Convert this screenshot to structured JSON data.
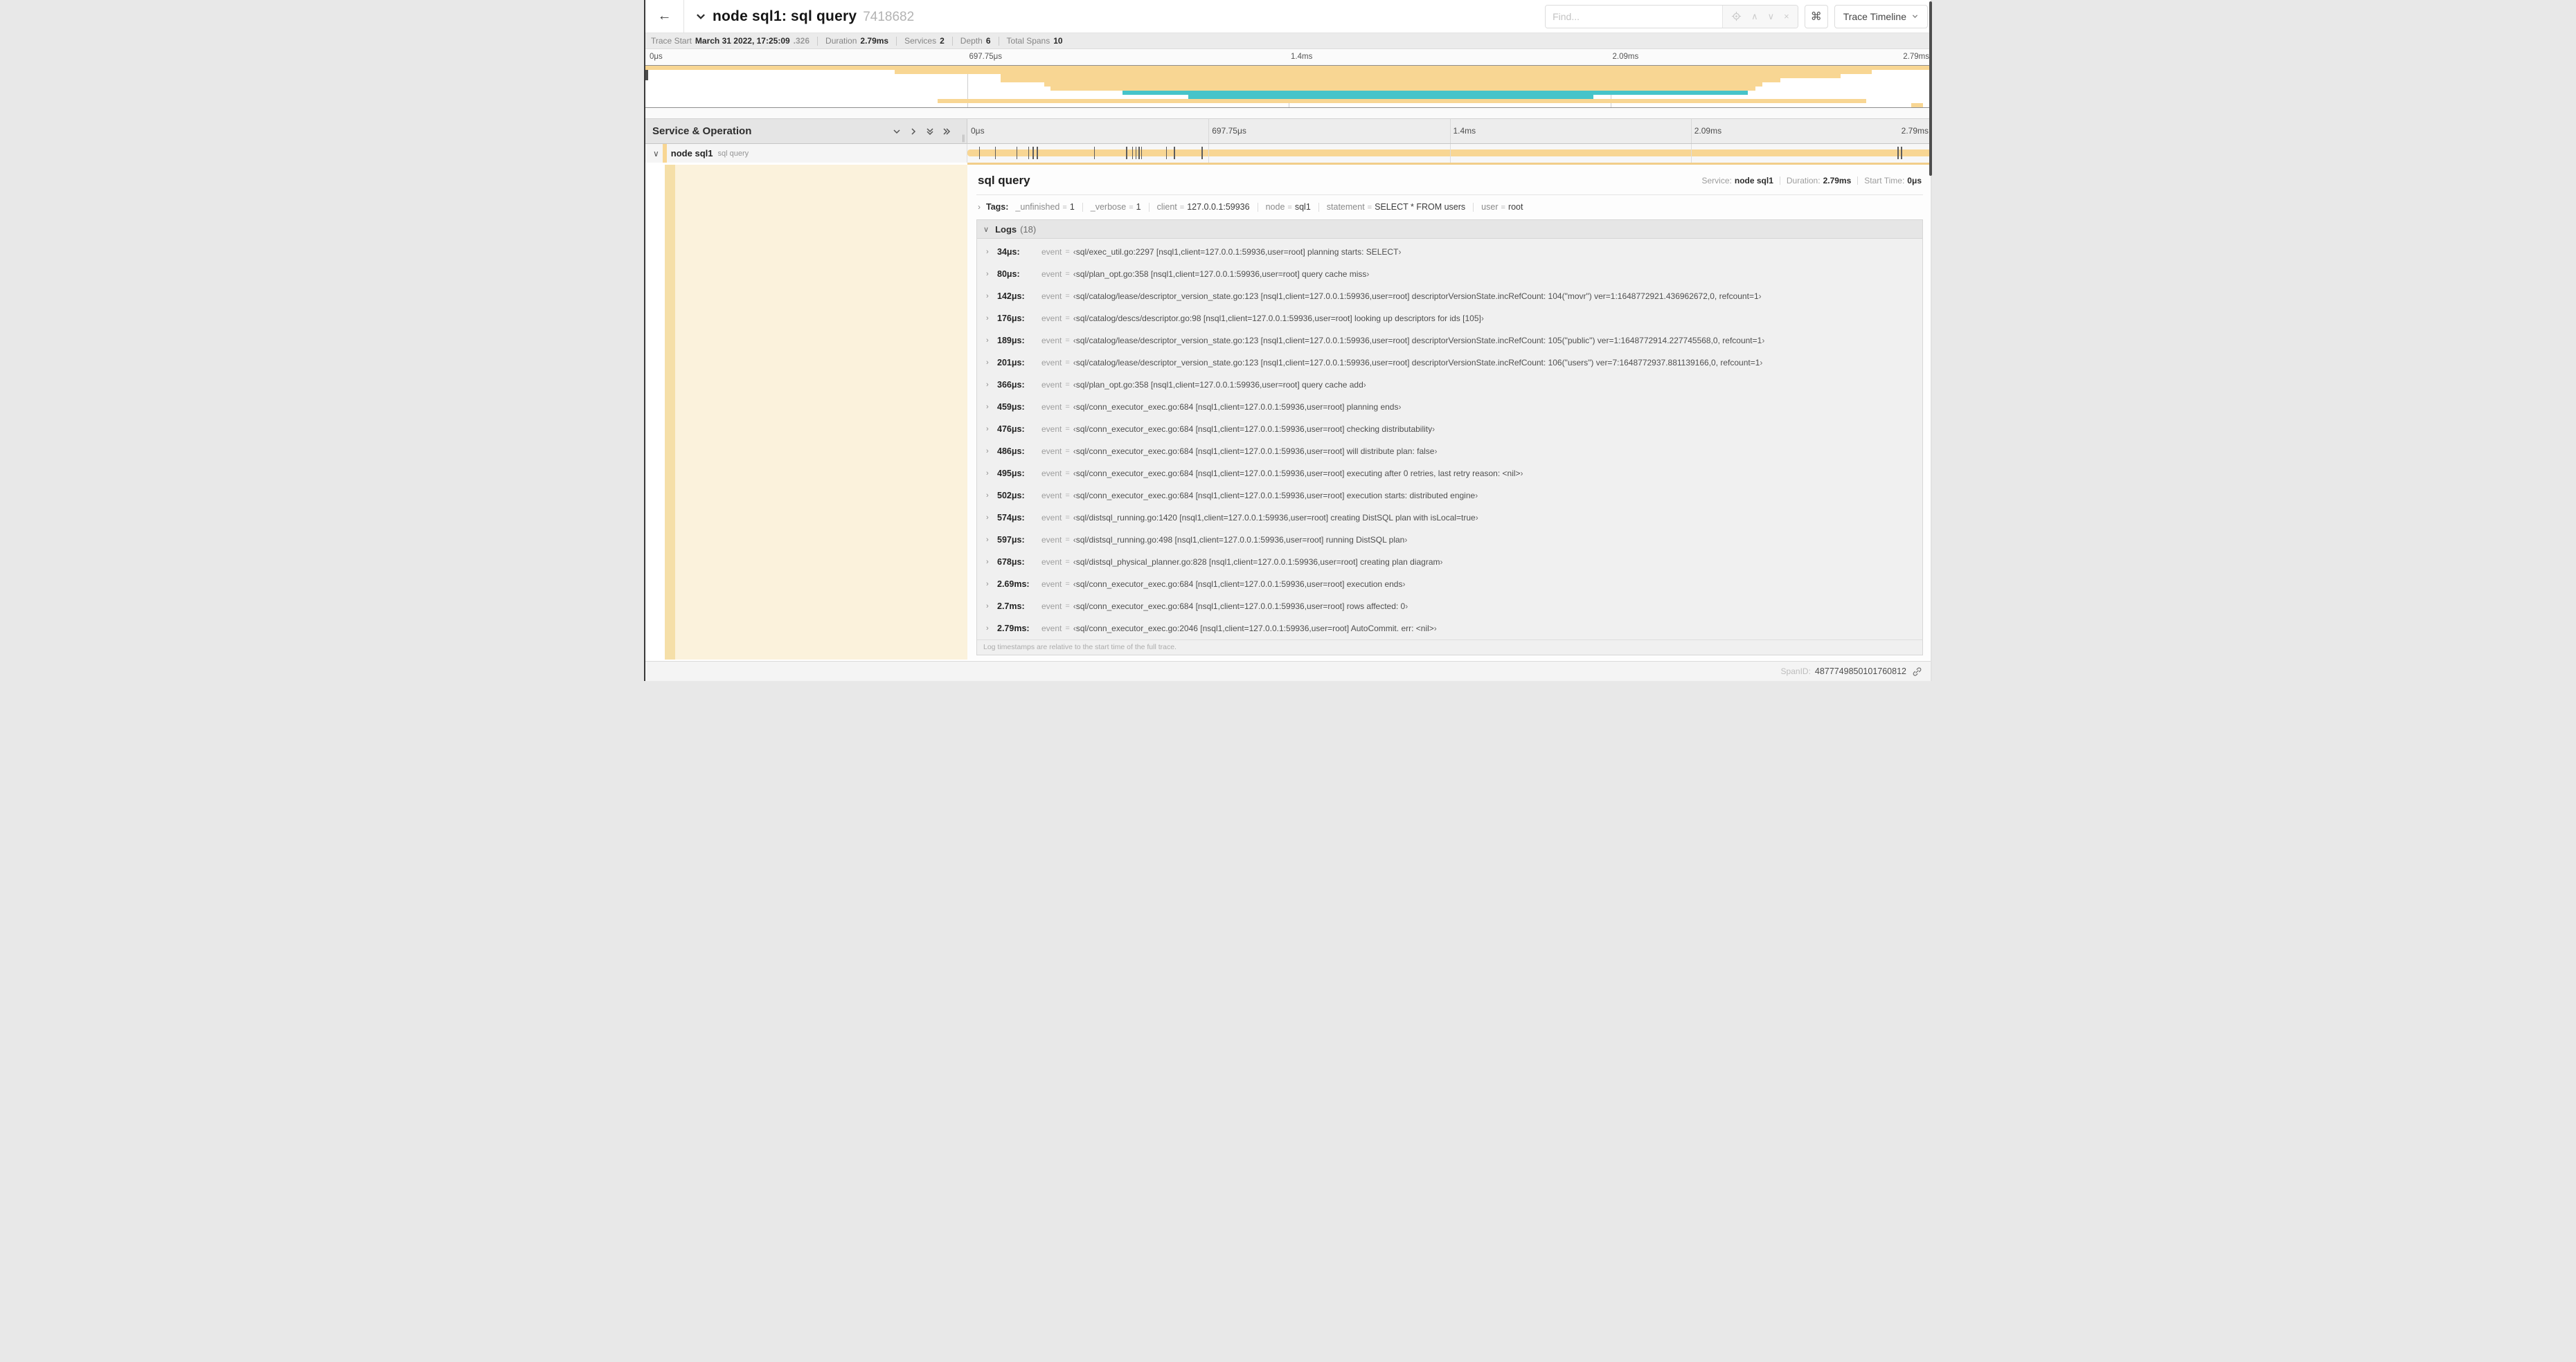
{
  "colors": {
    "span_tan": "#F8D693",
    "span_teal": "#46C4C9",
    "selected_cream": "#FBF2DC",
    "stripe_tan": "#F5DFA8",
    "accent_tan": "#F2CE8A"
  },
  "header": {
    "back_icon": "←",
    "title": "node sql1: sql query",
    "trace_id_short": "7418682",
    "find": {
      "placeholder": "Find...",
      "prev_icon": "∧",
      "next_icon": "∨",
      "clear_icon": "×"
    },
    "shortcut_button": "⌘",
    "view_button": {
      "label": "Trace Timeline"
    }
  },
  "trace_info": {
    "items": [
      {
        "label": "Trace Start",
        "value": "March 31 2022, 17:25:09",
        "suffix": ".326"
      },
      {
        "label": "Duration",
        "value": "2.79ms"
      },
      {
        "label": "Services",
        "value": "2"
      },
      {
        "label": "Depth",
        "value": "6"
      },
      {
        "label": "Total Spans",
        "value": "10"
      }
    ]
  },
  "timeline": {
    "tick_labels": [
      "0μs",
      "697.75μs",
      "1.4ms",
      "2.09ms",
      "2.79ms"
    ],
    "grid_pct": [
      25,
      50,
      75
    ]
  },
  "minimap": {
    "bars": [
      {
        "start": 0,
        "end": 100,
        "color": "tan"
      },
      {
        "start": 19.4,
        "end": 95.3,
        "color": "tan"
      },
      {
        "start": 27.6,
        "end": 92.9,
        "color": "tan"
      },
      {
        "start": 27.6,
        "end": 88.2,
        "color": "tan"
      },
      {
        "start": 31.0,
        "end": 86.8,
        "color": "tan"
      },
      {
        "start": 31.5,
        "end": 86.3,
        "color": "tan"
      },
      {
        "start": 37.1,
        "end": 85.7,
        "color": "teal"
      },
      {
        "start": 42.2,
        "end": 73.7,
        "color": "teal"
      },
      {
        "start": 22.7,
        "end": 94.9,
        "color": "tan"
      },
      {
        "start": 98.4,
        "end": 99.3,
        "color": "tan"
      }
    ]
  },
  "tree_header": {
    "title": "Service & Operation",
    "splitter_glyph": "∥"
  },
  "span_row": {
    "collapse_icon": "∨",
    "service": "node sql1",
    "operation": "sql query",
    "event_marks_pct": [
      1.22,
      2.87,
      5.09,
      6.31,
      6.77,
      7.2,
      13.12,
      16.45,
      17.06,
      17.42,
      17.74,
      17.99,
      20.57,
      21.4,
      24.3,
      96.42,
      96.77,
      100
    ]
  },
  "detail": {
    "title": "sql query",
    "meta": [
      {
        "label": "Service:",
        "value": "node sql1"
      },
      {
        "label": "Duration:",
        "value": "2.79ms"
      },
      {
        "label": "Start Time:",
        "value": "0μs"
      }
    ],
    "tags": {
      "expander_icon": "›",
      "label": "Tags:",
      "items": [
        {
          "key": "_unfinished",
          "value": "1"
        },
        {
          "key": "_verbose",
          "value": "1"
        },
        {
          "key": "client",
          "value": "127.0.0.1:59936"
        },
        {
          "key": "node",
          "value": "sql1"
        },
        {
          "key": "statement",
          "value": "SELECT * FROM users"
        },
        {
          "key": "user",
          "value": "root"
        }
      ]
    },
    "logs": {
      "collapse_icon": "∨",
      "label": "Logs",
      "count": "(18)",
      "row_expander_icon": "›",
      "event_key": "event",
      "quote_open": "‹",
      "quote_close": "›",
      "entries": [
        {
          "time": "34μs:",
          "message": "sql/exec_util.go:2297 [nsql1,client=127.0.0.1:59936,user=root] planning starts: SELECT"
        },
        {
          "time": "80μs:",
          "message": "sql/plan_opt.go:358 [nsql1,client=127.0.0.1:59936,user=root] query cache miss"
        },
        {
          "time": "142μs:",
          "message": "sql/catalog/lease/descriptor_version_state.go:123 [nsql1,client=127.0.0.1:59936,user=root] descriptorVersionState.incRefCount: 104(\"movr\") ver=1:1648772921.436962672,0, refcount=1"
        },
        {
          "time": "176μs:",
          "message": "sql/catalog/descs/descriptor.go:98 [nsql1,client=127.0.0.1:59936,user=root] looking up descriptors for ids [105]"
        },
        {
          "time": "189μs:",
          "message": "sql/catalog/lease/descriptor_version_state.go:123 [nsql1,client=127.0.0.1:59936,user=root] descriptorVersionState.incRefCount: 105(\"public\") ver=1:1648772914.227745568,0, refcount=1"
        },
        {
          "time": "201μs:",
          "message": "sql/catalog/lease/descriptor_version_state.go:123 [nsql1,client=127.0.0.1:59936,user=root] descriptorVersionState.incRefCount: 106(\"users\") ver=7:1648772937.881139166,0, refcount=1"
        },
        {
          "time": "366μs:",
          "message": "sql/plan_opt.go:358 [nsql1,client=127.0.0.1:59936,user=root] query cache add"
        },
        {
          "time": "459μs:",
          "message": "sql/conn_executor_exec.go:684 [nsql1,client=127.0.0.1:59936,user=root] planning ends"
        },
        {
          "time": "476μs:",
          "message": "sql/conn_executor_exec.go:684 [nsql1,client=127.0.0.1:59936,user=root] checking distributability"
        },
        {
          "time": "486μs:",
          "message": "sql/conn_executor_exec.go:684 [nsql1,client=127.0.0.1:59936,user=root] will distribute plan: false"
        },
        {
          "time": "495μs:",
          "message": "sql/conn_executor_exec.go:684 [nsql1,client=127.0.0.1:59936,user=root] executing after 0 retries, last retry reason: <nil>"
        },
        {
          "time": "502μs:",
          "message": "sql/conn_executor_exec.go:684 [nsql1,client=127.0.0.1:59936,user=root] execution starts: distributed engine"
        },
        {
          "time": "574μs:",
          "message": "sql/distsql_running.go:1420 [nsql1,client=127.0.0.1:59936,user=root] creating DistSQL plan with isLocal=true"
        },
        {
          "time": "597μs:",
          "message": "sql/distsql_running.go:498 [nsql1,client=127.0.0.1:59936,user=root] running DistSQL plan"
        },
        {
          "time": "678μs:",
          "message": "sql/distsql_physical_planner.go:828 [nsql1,client=127.0.0.1:59936,user=root] creating plan diagram"
        },
        {
          "time": "2.69ms:",
          "message": "sql/conn_executor_exec.go:684 [nsql1,client=127.0.0.1:59936,user=root] execution ends"
        },
        {
          "time": "2.7ms:",
          "message": "sql/conn_executor_exec.go:684 [nsql1,client=127.0.0.1:59936,user=root] rows affected: 0"
        },
        {
          "time": "2.79ms:",
          "message": "sql/conn_executor_exec.go:2046 [nsql1,client=127.0.0.1:59936,user=root] AutoCommit. err: <nil>"
        }
      ]
    },
    "footnote": "Log timestamps are relative to the start time of the full trace.",
    "span_id": {
      "label": "SpanID:",
      "value": "4877749850101760812"
    }
  }
}
